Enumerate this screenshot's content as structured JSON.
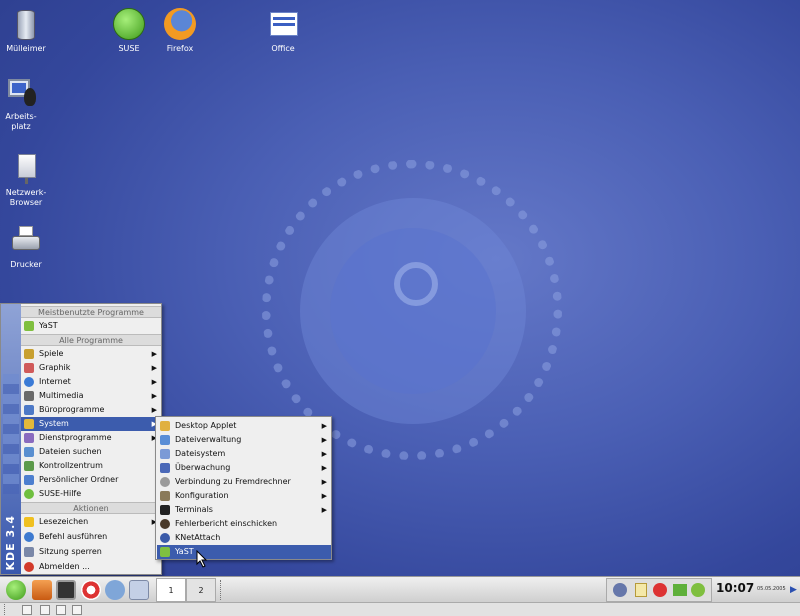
{
  "desktop": {
    "icons": [
      {
        "label": "Mülleimer"
      },
      {
        "label": "SUSE"
      },
      {
        "label": "Firefox"
      },
      {
        "label": "Office"
      },
      {
        "label": "Arbeits-\nplatz"
      },
      {
        "label": "Netzwerk-\nBrowser"
      },
      {
        "label": "Drucker"
      }
    ]
  },
  "kmenu": {
    "brand": "KDE 3.4",
    "header_most_used": "Meistbenutzte Programme",
    "most_used": [
      {
        "label": "YaST"
      }
    ],
    "header_all": "Alle Programme",
    "items": [
      {
        "label": "Spiele"
      },
      {
        "label": "Graphik"
      },
      {
        "label": "Internet"
      },
      {
        "label": "Multimedia"
      },
      {
        "label": "Büroprogramme"
      },
      {
        "label": "System"
      },
      {
        "label": "Dienstprogramme"
      },
      {
        "label": "Dateien suchen"
      },
      {
        "label": "Kontrollzentrum"
      },
      {
        "label": "Persönlicher Ordner"
      },
      {
        "label": "SUSE-Hilfe"
      }
    ],
    "header_actions": "Aktionen",
    "actions": [
      {
        "label": "Lesezeichen"
      },
      {
        "label": "Befehl ausführen"
      },
      {
        "label": "Sitzung sperren"
      },
      {
        "label": "Abmelden ..."
      }
    ]
  },
  "submenu_system": {
    "items": [
      {
        "label": "Desktop Applet"
      },
      {
        "label": "Dateiverwaltung"
      },
      {
        "label": "Dateisystem"
      },
      {
        "label": "Überwachung"
      },
      {
        "label": "Verbindung zu Fremdrechner"
      },
      {
        "label": "Konfiguration"
      },
      {
        "label": "Terminals"
      },
      {
        "label": "Fehlerbericht einschicken"
      },
      {
        "label": "KNetAttach"
      },
      {
        "label": "YaST"
      }
    ]
  },
  "panel": {
    "pager": [
      "1",
      "2"
    ],
    "clock": "10:07",
    "date": "05.05.2005"
  },
  "colors": {
    "selection": "#3c5cad",
    "desktop": "#4a5fb4"
  }
}
